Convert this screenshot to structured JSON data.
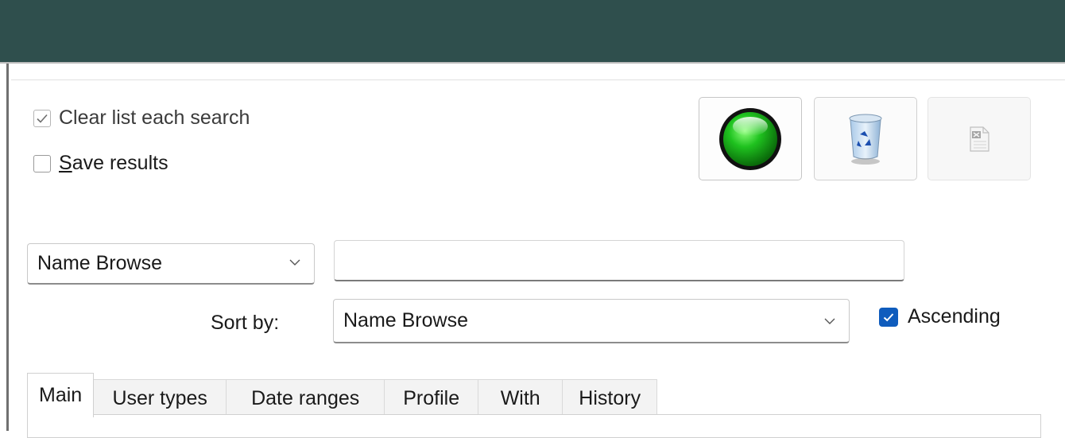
{
  "options": {
    "clear_list_label": "Clear list each search",
    "clear_list_checked": true,
    "save_results_label": "Save results",
    "save_results_checked": false
  },
  "toolbar": {
    "go_icon": "green-circle-go-icon",
    "clear_icon": "recycle-bin-icon",
    "export_icon": "export-excel-icon",
    "export_enabled": false
  },
  "search": {
    "mode_selected": "Name Browse",
    "query_value": ""
  },
  "sort": {
    "label": "Sort by:",
    "selected": "Name Browse",
    "ascending_label": "Ascending",
    "ascending_checked": true
  },
  "tabs": [
    {
      "label": "Main",
      "active": true
    },
    {
      "label": "User types",
      "active": false
    },
    {
      "label": "Date ranges",
      "active": false
    },
    {
      "label": "Profile",
      "active": false
    },
    {
      "label": "With",
      "active": false
    },
    {
      "label": "History",
      "active": false
    }
  ],
  "colors": {
    "titlebar": "#2f4f4d",
    "accent": "#0f5cbd",
    "go_green": "#1fa31f"
  }
}
